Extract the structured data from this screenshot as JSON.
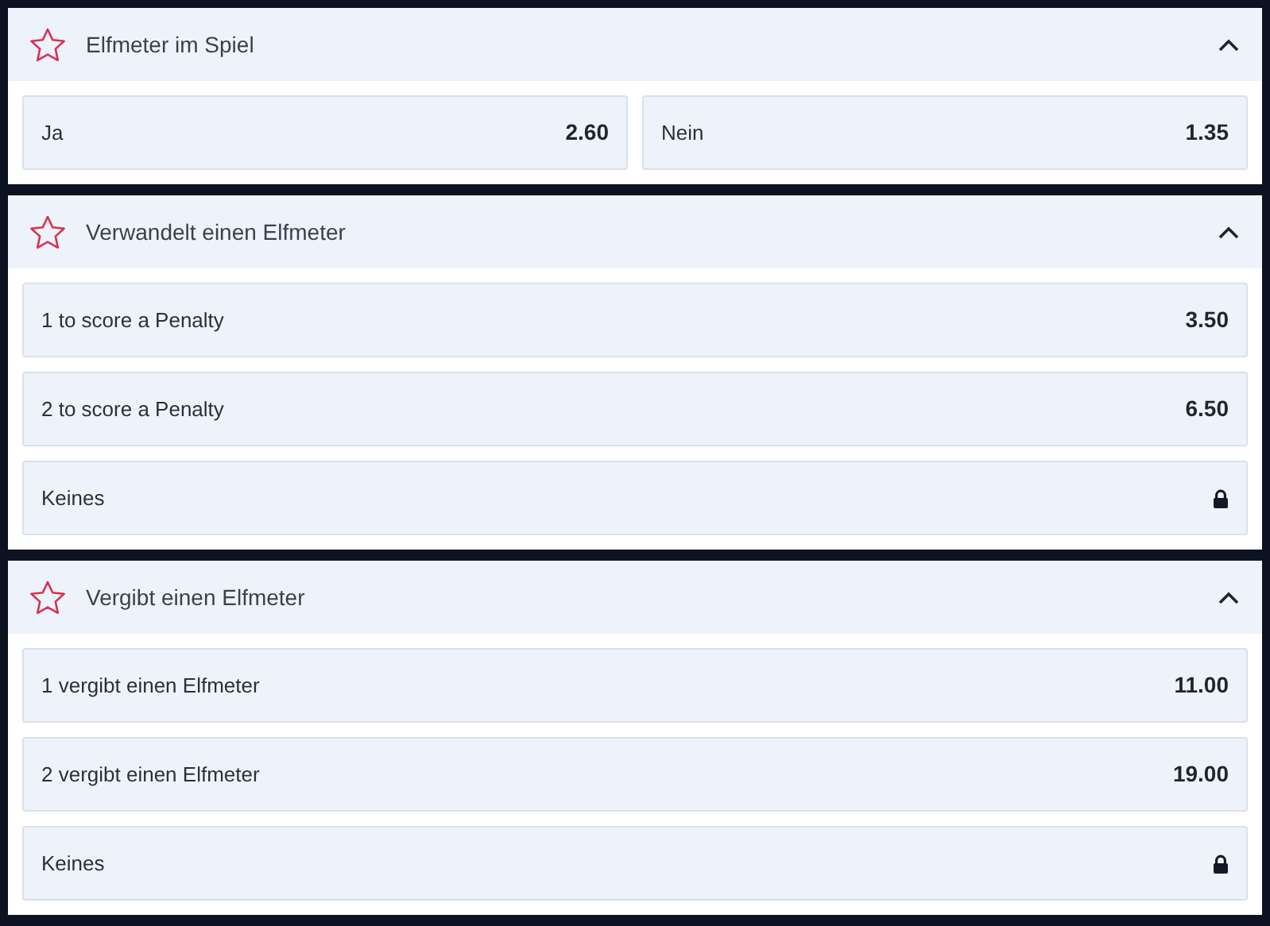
{
  "markets": [
    {
      "title": "Elfmeter im Spiel",
      "expanded": true,
      "side_by_side": true,
      "options": [
        {
          "kind": "odds",
          "label": "Ja",
          "odds": "2.60"
        },
        {
          "kind": "odds",
          "label": "Nein",
          "odds": "1.35"
        }
      ]
    },
    {
      "title": "Verwandelt einen Elfmeter",
      "expanded": true,
      "side_by_side": false,
      "options": [
        {
          "kind": "odds",
          "label": "1 to score a Penalty",
          "odds": "3.50"
        },
        {
          "kind": "odds",
          "label": "2 to score a Penalty",
          "odds": "6.50"
        },
        {
          "kind": "locked",
          "label": "Keines"
        }
      ]
    },
    {
      "title": "Vergibt einen Elfmeter",
      "expanded": true,
      "side_by_side": false,
      "options": [
        {
          "kind": "odds",
          "label": "1 vergibt einen Elfmeter",
          "odds": "11.00"
        },
        {
          "kind": "odds",
          "label": "2 vergibt einen Elfmeter",
          "odds": "19.00"
        },
        {
          "kind": "locked",
          "label": "Keines"
        }
      ]
    }
  ]
}
